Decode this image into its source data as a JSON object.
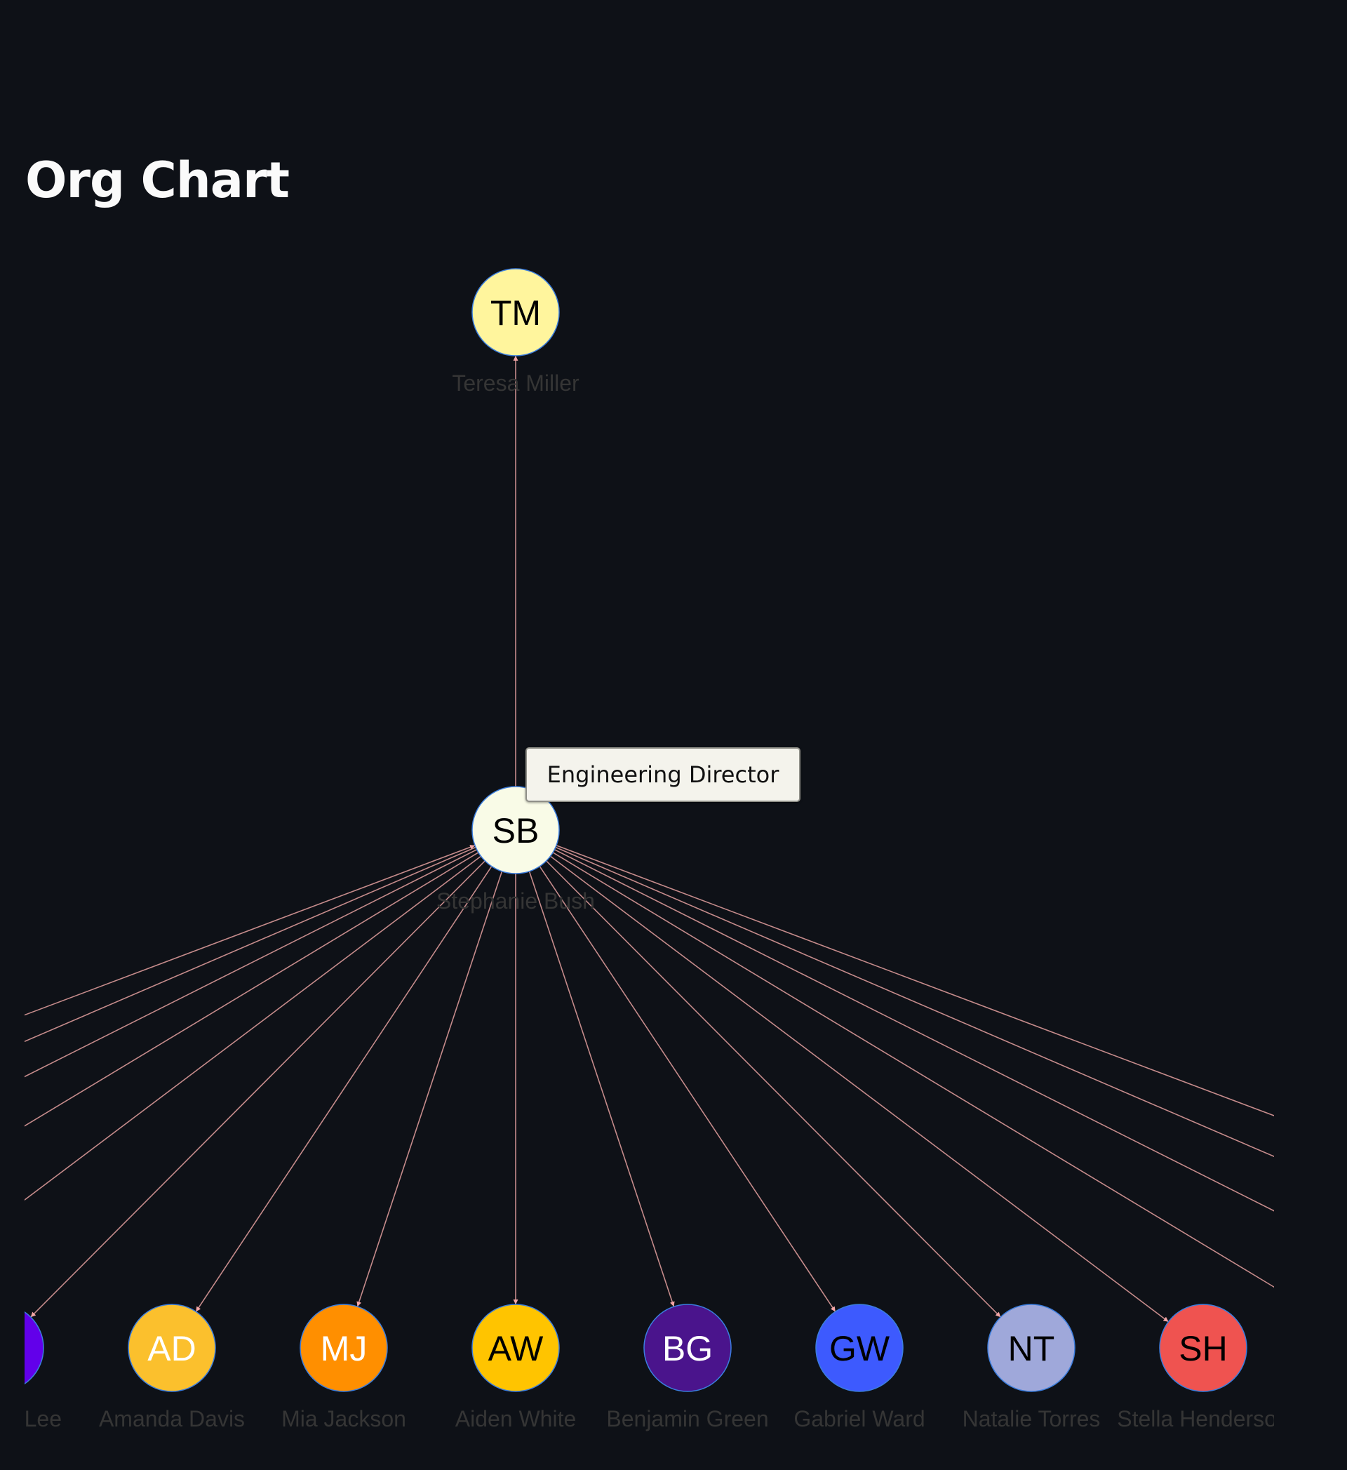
{
  "page": {
    "title": "Org Chart"
  },
  "tooltip": {
    "text": "Engineering Director",
    "target": "SB"
  },
  "colors": {
    "background": "#0e1117",
    "edge": "#c58b8b",
    "arrow": "#f4a6a6",
    "node_border": "#3b7ddd",
    "label": "#353535"
  },
  "org": {
    "levels": [
      {
        "nodes": [
          {
            "id": "TM",
            "initials": "TM",
            "name": "Teresa Miller",
            "fill": "#fff59d",
            "text_color": "#000000"
          }
        ]
      },
      {
        "nodes": [
          {
            "id": "SB",
            "initials": "SB",
            "name": "Stephanie Bush",
            "fill": "#f9fbe7",
            "text_color": "#000000",
            "role": "Engineering Director"
          }
        ]
      },
      {
        "nodes": [
          {
            "id": "off-left-5",
            "initials": "",
            "name": "",
            "fill": "",
            "text_color": "",
            "arrow_to_parent": true
          },
          {
            "id": "off-left-4",
            "initials": "",
            "name": "",
            "fill": "",
            "text_color": ""
          },
          {
            "id": "off-left-3",
            "initials": "",
            "name": "",
            "fill": "",
            "text_color": ""
          },
          {
            "id": "off-left-2",
            "initials": "",
            "name": "",
            "fill": "",
            "text_color": ""
          },
          {
            "id": "off-left-1",
            "initials": "",
            "name": "",
            "fill": "",
            "text_color": ""
          },
          {
            "id": "partial-left",
            "initials": "",
            "name": "er Lee",
            "fill": "#6200ea",
            "text_color": "#ffffff",
            "label_partial": true
          },
          {
            "id": "AD",
            "initials": "AD",
            "name": "Amanda Davis",
            "fill": "#fbc02d",
            "text_color": "#ffffff"
          },
          {
            "id": "MJ",
            "initials": "MJ",
            "name": "Mia Jackson",
            "fill": "#ff8f00",
            "text_color": "#ffffff"
          },
          {
            "id": "AW",
            "initials": "AW",
            "name": "Aiden White",
            "fill": "#ffc400",
            "text_color": "#000000"
          },
          {
            "id": "BG",
            "initials": "BG",
            "name": "Benjamin Green",
            "fill": "#4a148c",
            "text_color": "#ffffff"
          },
          {
            "id": "GW",
            "initials": "GW",
            "name": "Gabriel Ward",
            "fill": "#3d5afe",
            "text_color": "#000000"
          },
          {
            "id": "NT",
            "initials": "NT",
            "name": "Natalie Torres",
            "fill": "#9fa8da",
            "text_color": "#000000"
          },
          {
            "id": "SH",
            "initials": "SH",
            "name": "Stella Henderson",
            "fill": "#ef5350",
            "text_color": "#000000"
          },
          {
            "id": "off-right-1",
            "initials": "",
            "name": "",
            "fill": "",
            "text_color": ""
          },
          {
            "id": "off-right-2",
            "initials": "",
            "name": "",
            "fill": "",
            "text_color": ""
          },
          {
            "id": "off-right-3",
            "initials": "",
            "name": "",
            "fill": "",
            "text_color": ""
          },
          {
            "id": "off-right-4",
            "initials": "",
            "name": "",
            "fill": "",
            "text_color": ""
          }
        ]
      }
    ],
    "edges": [
      {
        "from": "SB",
        "to": "TM",
        "direction": "up"
      }
    ]
  }
}
